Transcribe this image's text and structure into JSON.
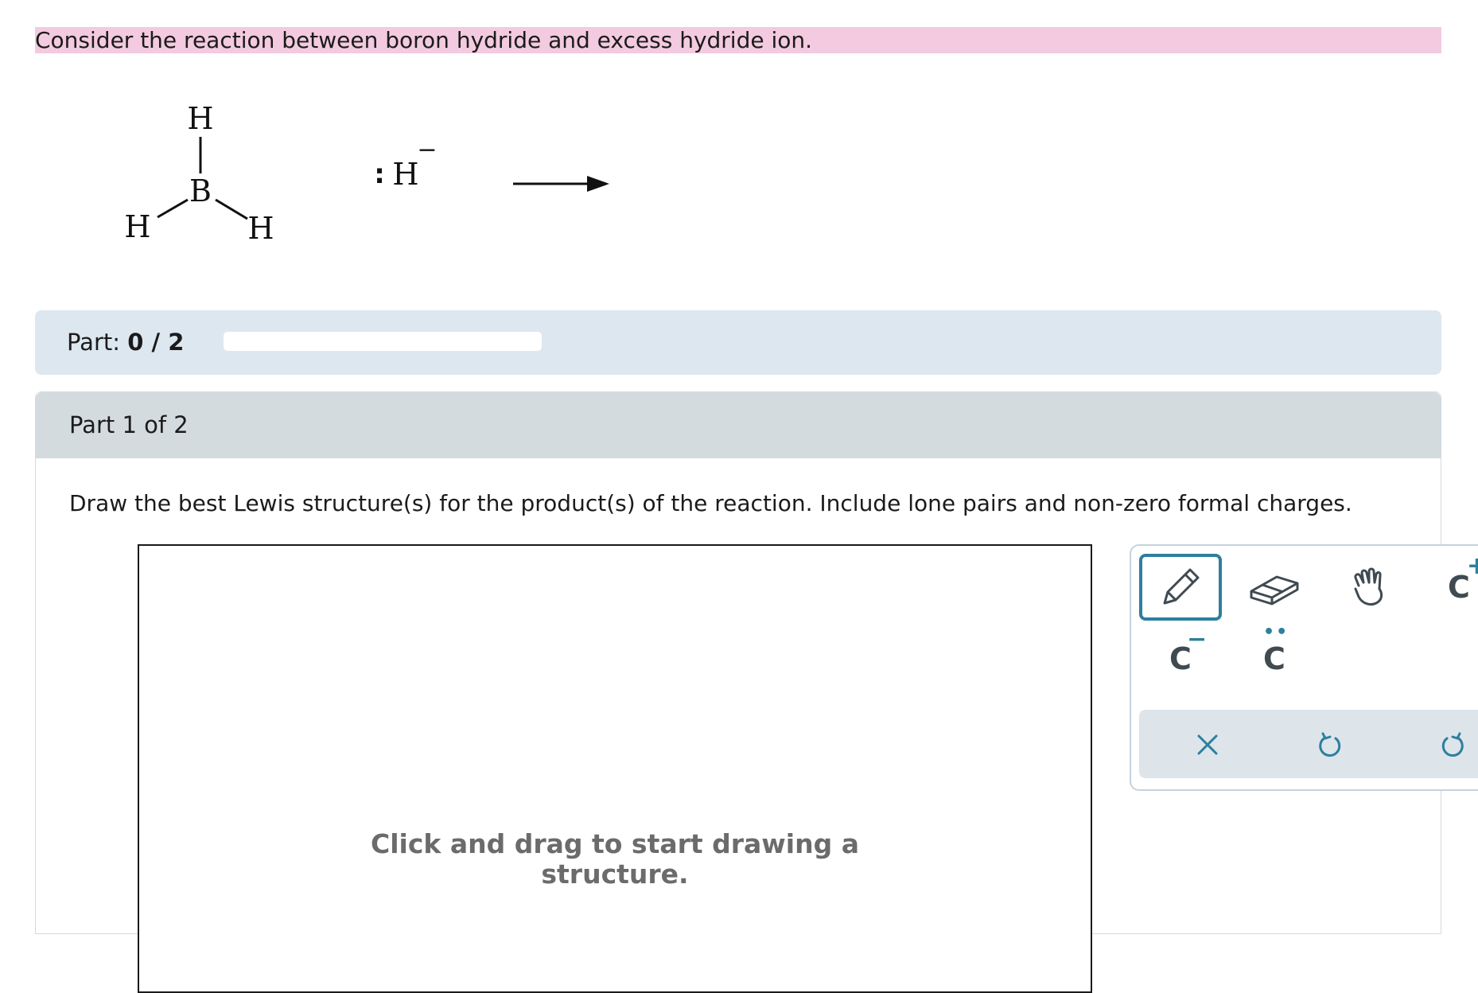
{
  "question": {
    "text": "Consider the reaction between boron hydride and excess hydride ion."
  },
  "reaction": {
    "reactant1": {
      "center_atom": "B",
      "top": "H",
      "left": "H",
      "right": "H"
    },
    "reactant2": {
      "atom": "H",
      "lone_pair": ":",
      "charge": "−"
    }
  },
  "progress": {
    "label": "Part:",
    "value": "0 / 2",
    "completed": 0,
    "total": 2
  },
  "part": {
    "header": "Part 1 of 2",
    "instructions": "Draw the best Lewis structure(s) for the product(s) of the reaction. Include lone pairs and non-zero formal charges.",
    "canvas_hint": "Click and drag to start drawing a structure."
  },
  "toolbox": {
    "tools": [
      {
        "name": "pencil",
        "icon": "pencil-icon",
        "active": true
      },
      {
        "name": "eraser",
        "icon": "eraser-icon",
        "active": false
      },
      {
        "name": "move",
        "icon": "hand-icon",
        "active": false
      },
      {
        "name": "positive charge",
        "icon": "positive-charge-icon",
        "letter": "C",
        "sup": "+"
      },
      {
        "name": "negative charge",
        "icon": "negative-charge-icon",
        "letter": "C",
        "sup": "−"
      },
      {
        "name": "lone pair",
        "icon": "lone-pair-icon",
        "letter": "C",
        "sup": "••"
      }
    ],
    "actions": [
      {
        "name": "clear",
        "icon": "close-icon"
      },
      {
        "name": "undo",
        "icon": "undo-icon"
      },
      {
        "name": "redo",
        "icon": "redo-icon"
      }
    ]
  },
  "colors": {
    "banner": "#f3cadf",
    "accent": "#2d7f9e",
    "progress_bg": "#dde7f0",
    "part_header_bg": "#d4dbdf"
  }
}
